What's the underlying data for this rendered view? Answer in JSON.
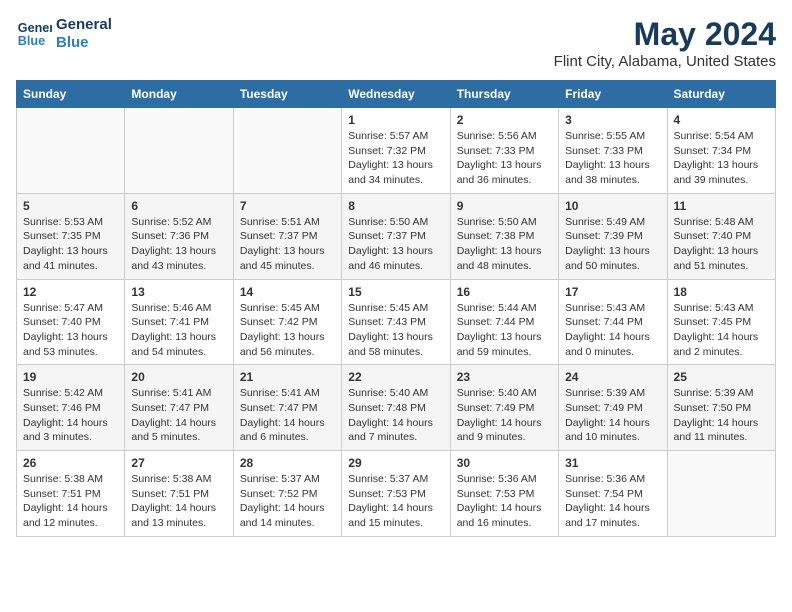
{
  "logo": {
    "line1": "General",
    "line2": "Blue"
  },
  "title": "May 2024",
  "subtitle": "Flint City, Alabama, United States",
  "days_of_week": [
    "Sunday",
    "Monday",
    "Tuesday",
    "Wednesday",
    "Thursday",
    "Friday",
    "Saturday"
  ],
  "weeks": [
    [
      {
        "num": "",
        "info": ""
      },
      {
        "num": "",
        "info": ""
      },
      {
        "num": "",
        "info": ""
      },
      {
        "num": "1",
        "info": "Sunrise: 5:57 AM\nSunset: 7:32 PM\nDaylight: 13 hours\nand 34 minutes."
      },
      {
        "num": "2",
        "info": "Sunrise: 5:56 AM\nSunset: 7:33 PM\nDaylight: 13 hours\nand 36 minutes."
      },
      {
        "num": "3",
        "info": "Sunrise: 5:55 AM\nSunset: 7:33 PM\nDaylight: 13 hours\nand 38 minutes."
      },
      {
        "num": "4",
        "info": "Sunrise: 5:54 AM\nSunset: 7:34 PM\nDaylight: 13 hours\nand 39 minutes."
      }
    ],
    [
      {
        "num": "5",
        "info": "Sunrise: 5:53 AM\nSunset: 7:35 PM\nDaylight: 13 hours\nand 41 minutes."
      },
      {
        "num": "6",
        "info": "Sunrise: 5:52 AM\nSunset: 7:36 PM\nDaylight: 13 hours\nand 43 minutes."
      },
      {
        "num": "7",
        "info": "Sunrise: 5:51 AM\nSunset: 7:37 PM\nDaylight: 13 hours\nand 45 minutes."
      },
      {
        "num": "8",
        "info": "Sunrise: 5:50 AM\nSunset: 7:37 PM\nDaylight: 13 hours\nand 46 minutes."
      },
      {
        "num": "9",
        "info": "Sunrise: 5:50 AM\nSunset: 7:38 PM\nDaylight: 13 hours\nand 48 minutes."
      },
      {
        "num": "10",
        "info": "Sunrise: 5:49 AM\nSunset: 7:39 PM\nDaylight: 13 hours\nand 50 minutes."
      },
      {
        "num": "11",
        "info": "Sunrise: 5:48 AM\nSunset: 7:40 PM\nDaylight: 13 hours\nand 51 minutes."
      }
    ],
    [
      {
        "num": "12",
        "info": "Sunrise: 5:47 AM\nSunset: 7:40 PM\nDaylight: 13 hours\nand 53 minutes."
      },
      {
        "num": "13",
        "info": "Sunrise: 5:46 AM\nSunset: 7:41 PM\nDaylight: 13 hours\nand 54 minutes."
      },
      {
        "num": "14",
        "info": "Sunrise: 5:45 AM\nSunset: 7:42 PM\nDaylight: 13 hours\nand 56 minutes."
      },
      {
        "num": "15",
        "info": "Sunrise: 5:45 AM\nSunset: 7:43 PM\nDaylight: 13 hours\nand 58 minutes."
      },
      {
        "num": "16",
        "info": "Sunrise: 5:44 AM\nSunset: 7:44 PM\nDaylight: 13 hours\nand 59 minutes."
      },
      {
        "num": "17",
        "info": "Sunrise: 5:43 AM\nSunset: 7:44 PM\nDaylight: 14 hours\nand 0 minutes."
      },
      {
        "num": "18",
        "info": "Sunrise: 5:43 AM\nSunset: 7:45 PM\nDaylight: 14 hours\nand 2 minutes."
      }
    ],
    [
      {
        "num": "19",
        "info": "Sunrise: 5:42 AM\nSunset: 7:46 PM\nDaylight: 14 hours\nand 3 minutes."
      },
      {
        "num": "20",
        "info": "Sunrise: 5:41 AM\nSunset: 7:47 PM\nDaylight: 14 hours\nand 5 minutes."
      },
      {
        "num": "21",
        "info": "Sunrise: 5:41 AM\nSunset: 7:47 PM\nDaylight: 14 hours\nand 6 minutes."
      },
      {
        "num": "22",
        "info": "Sunrise: 5:40 AM\nSunset: 7:48 PM\nDaylight: 14 hours\nand 7 minutes."
      },
      {
        "num": "23",
        "info": "Sunrise: 5:40 AM\nSunset: 7:49 PM\nDaylight: 14 hours\nand 9 minutes."
      },
      {
        "num": "24",
        "info": "Sunrise: 5:39 AM\nSunset: 7:49 PM\nDaylight: 14 hours\nand 10 minutes."
      },
      {
        "num": "25",
        "info": "Sunrise: 5:39 AM\nSunset: 7:50 PM\nDaylight: 14 hours\nand 11 minutes."
      }
    ],
    [
      {
        "num": "26",
        "info": "Sunrise: 5:38 AM\nSunset: 7:51 PM\nDaylight: 14 hours\nand 12 minutes."
      },
      {
        "num": "27",
        "info": "Sunrise: 5:38 AM\nSunset: 7:51 PM\nDaylight: 14 hours\nand 13 minutes."
      },
      {
        "num": "28",
        "info": "Sunrise: 5:37 AM\nSunset: 7:52 PM\nDaylight: 14 hours\nand 14 minutes."
      },
      {
        "num": "29",
        "info": "Sunrise: 5:37 AM\nSunset: 7:53 PM\nDaylight: 14 hours\nand 15 minutes."
      },
      {
        "num": "30",
        "info": "Sunrise: 5:36 AM\nSunset: 7:53 PM\nDaylight: 14 hours\nand 16 minutes."
      },
      {
        "num": "31",
        "info": "Sunrise: 5:36 AM\nSunset: 7:54 PM\nDaylight: 14 hours\nand 17 minutes."
      },
      {
        "num": "",
        "info": ""
      }
    ]
  ]
}
